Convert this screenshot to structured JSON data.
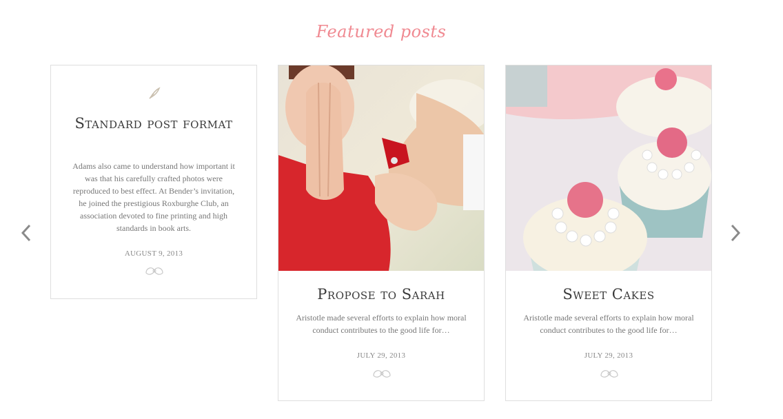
{
  "section": {
    "title": "Featured posts"
  },
  "nav": {
    "prev_icon": "chevron-left-icon",
    "next_icon": "chevron-right-icon"
  },
  "colors": {
    "accent": "#f08a92",
    "border": "#dedede",
    "text": "#3a3a3a",
    "muted": "#777777"
  },
  "posts": [
    {
      "title": "Standard post format",
      "icon": "quill-icon",
      "excerpt": "Adams also came to understand how important it was that his carefully crafted photos were reproduced to best effect. At Bender’s invitation, he joined the prestigious Roxburghe Club, an association devoted to fine printing and high standards in book arts.",
      "date": "AUGUST 9, 2013"
    },
    {
      "title": "Propose to Sarah",
      "image": "proposal-ring-photo",
      "excerpt": "Aristotle made several efforts to explain how moral conduct contributes to the good life for…",
      "date": "JULY 29, 2013"
    },
    {
      "title": "Sweet Cakes",
      "image": "cupcakes-photo",
      "excerpt": "Aristotle made several efforts to explain how moral conduct contributes to the good life for…",
      "date": "JULY 29, 2013"
    }
  ]
}
